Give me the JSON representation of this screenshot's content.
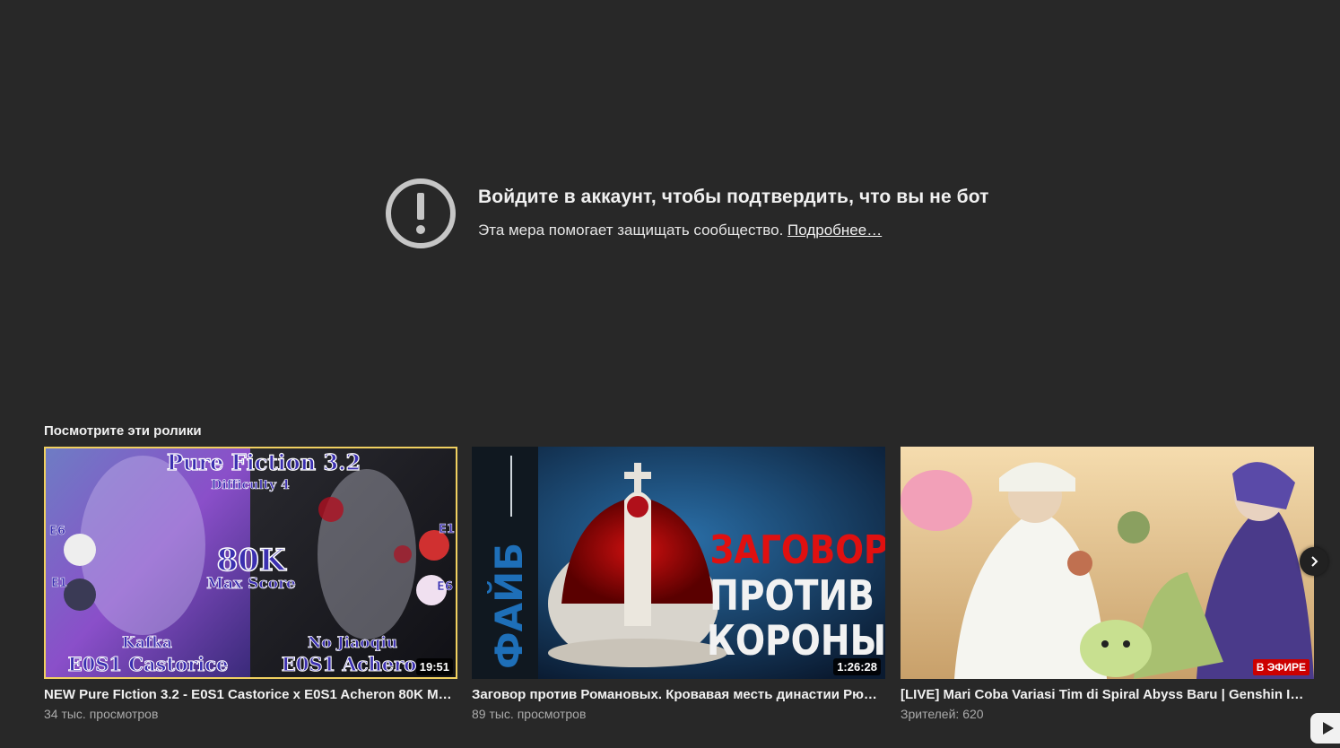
{
  "notice": {
    "title": "Войдите в аккаунт, чтобы подтвердить, что вы не бот",
    "subtitle": "Эта мера помогает защищать сообщество.",
    "link": "Подробнее…",
    "icon": "alert-circle-icon"
  },
  "section": {
    "title": "Посмотрите эти ролики"
  },
  "videos": [
    {
      "title": "NEW Pure FIction 3.2 - E0S1 Castorice x E0S1 Acheron 80K Ma…",
      "meta": "34 тыс. просмотров",
      "badge": "19:51",
      "thumb": {
        "top": "Pure Fiction 3.2",
        "sub": "Difficulty 4",
        "score": "80K",
        "score_label": "Max Score",
        "left_small": "Kafka",
        "left_big": "E0S1 Castorice",
        "right_small": "No Jiaoqiu",
        "right_big": "E0S1 Achero",
        "tags": [
          "E6",
          "E1",
          "E1",
          "E6"
        ]
      }
    },
    {
      "title": "Заговор против Романовых. Кровавая месть династии Рю…",
      "meta": "89 тыс. просмотров",
      "badge": "1:26:28",
      "thumb": {
        "side": "ФАЙБ",
        "line1": "ЗАГОВОР",
        "line2": "ПРОТИВ",
        "line3": "КОРОНЫ"
      }
    },
    {
      "title": "[LIVE] Mari Coba Variasi Tim di Spiral Abyss Baru | Genshin Im…",
      "meta": "Зрителей: 620",
      "badge": "В ЭФИРЕ"
    }
  ]
}
